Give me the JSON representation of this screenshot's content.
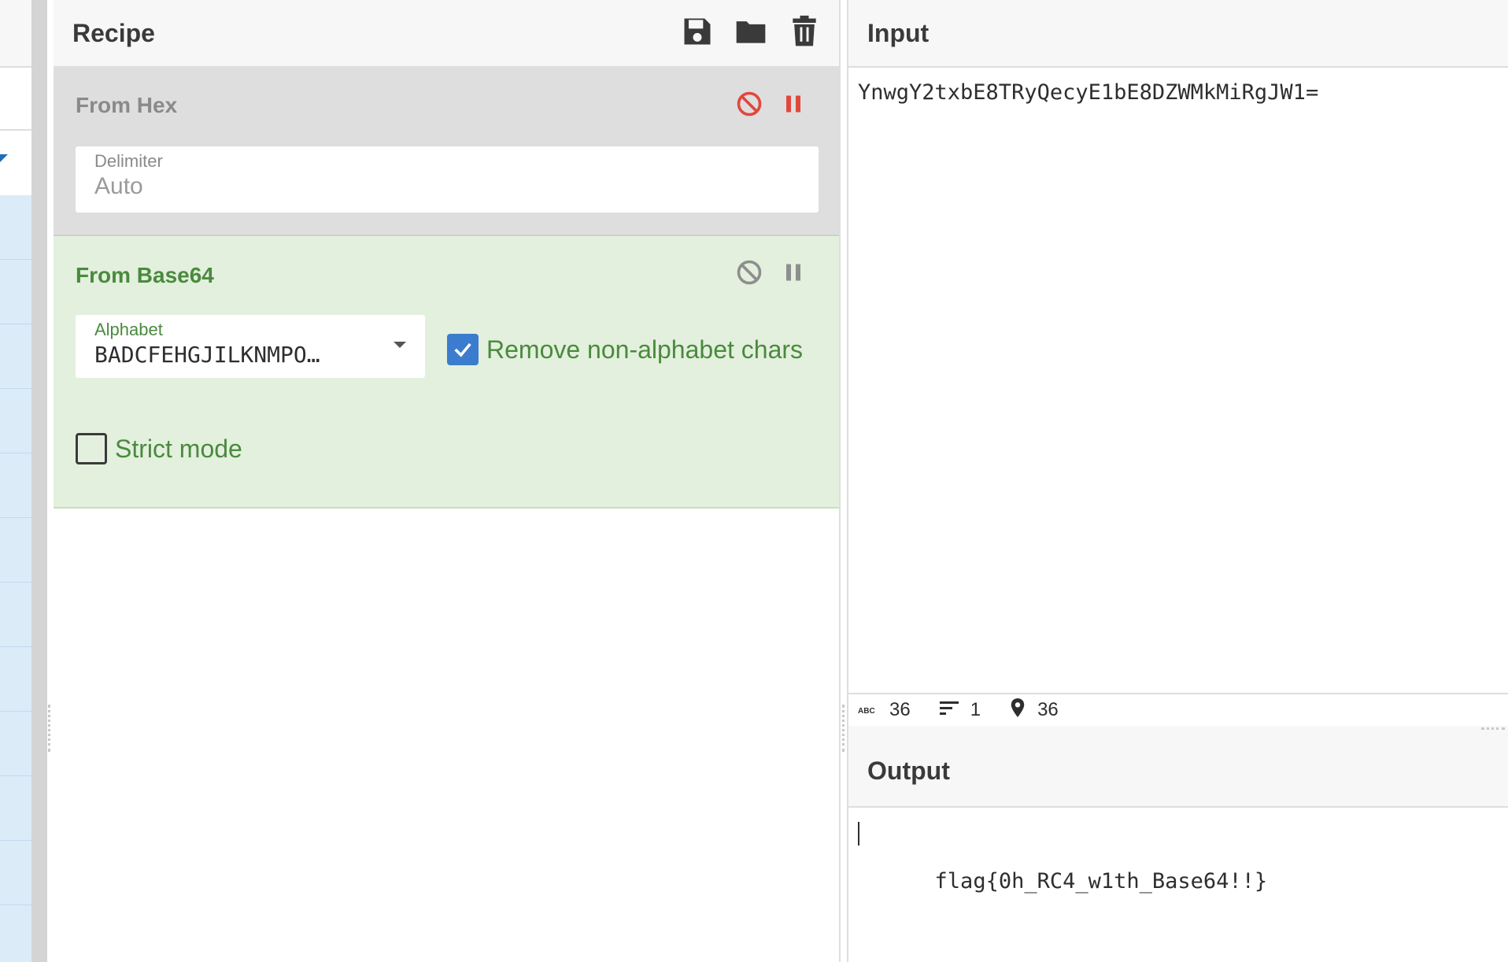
{
  "recipe": {
    "title": "Recipe",
    "operations": [
      {
        "name": "From Hex",
        "status": "disabled",
        "args": {
          "delimiter_label": "Delimiter",
          "delimiter_value": "Auto"
        }
      },
      {
        "name": "From Base64",
        "status": "active",
        "args": {
          "alphabet_label": "Alphabet",
          "alphabet_value": "BADCFEHGJILKNMPO…",
          "remove_label": "Remove non-alphabet chars",
          "remove_checked": true,
          "strict_label": "Strict mode",
          "strict_checked": false
        }
      }
    ]
  },
  "input": {
    "title": "Input",
    "text": "YnwgY2txbE8TRyQecyE1bE8DZWMkMiRgJW1=",
    "status": {
      "chars": "36",
      "lines": "1",
      "position": "36"
    }
  },
  "output": {
    "title": "Output",
    "text": "flag{0h_RC4_w1th_Base64!!}"
  },
  "colors": {
    "accent_blue": "#3b7ccf",
    "active_green": "#4a8a3e",
    "disable_red": "#e0483e"
  },
  "icons": [
    "save-icon",
    "folder-icon",
    "trash-icon",
    "disable-icon",
    "pause-icon",
    "abc-icon",
    "lines-icon",
    "location-pin-icon"
  ]
}
